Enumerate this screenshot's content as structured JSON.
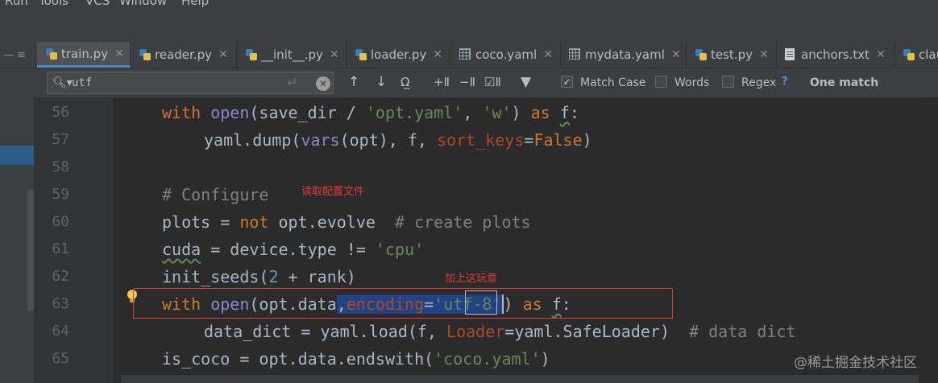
{
  "menu": [
    "Run",
    "Tools",
    "VCS",
    "Window",
    "Help"
  ],
  "tabs": [
    {
      "label": "train.py",
      "icon": "python-file-icon",
      "active": true
    },
    {
      "label": "reader.py",
      "icon": "python-file-icon"
    },
    {
      "label": "__init__.py",
      "icon": "python-file-icon"
    },
    {
      "label": "loader.py",
      "icon": "python-file-icon"
    },
    {
      "label": "coco.yaml",
      "icon": "yaml-file-icon"
    },
    {
      "label": "mydata.yaml",
      "icon": "yaml-file-icon"
    },
    {
      "label": "test.py",
      "icon": "python-file-icon"
    },
    {
      "label": "anchors.txt",
      "icon": "text-file-icon"
    },
    {
      "label": "clau",
      "icon": "python-file-icon"
    }
  ],
  "find": {
    "query": "utf",
    "match_case_label": "Match Case",
    "match_case_checked": true,
    "words_label": "Words",
    "words_checked": false,
    "regex_label": "Regex",
    "regex_checked": false,
    "help": "?",
    "result": "One match"
  },
  "line_numbers": [
    "56",
    "57",
    "58",
    "59",
    "60",
    "61",
    "62",
    "63",
    "64",
    "65"
  ],
  "code": {
    "l56": {
      "kw": "with",
      "fn": "open",
      "a": "(save_dir / ",
      "s1": "'opt.yaml'",
      "b": ", ",
      "s2": "'w'",
      "c": ") ",
      "as": "as",
      "d": " ",
      "f": "f",
      "e": ":"
    },
    "l57": {
      "a": "yaml.dump(",
      "fn": "vars",
      "b": "(opt), f, ",
      "p": "sort_keys",
      "eq": "=",
      "kw": "False",
      "c": ")"
    },
    "l59": {
      "comment": "# Configure"
    },
    "l60": {
      "a": "plots = ",
      "kw": "not",
      "b": " opt.evolve  ",
      "comment": "# create plots"
    },
    "l61": {
      "id": "cuda",
      "a": " = device.type != ",
      "s": "'cpu'"
    },
    "l62": {
      "a": "init_seeds(",
      "n": "2",
      "b": " + rank)"
    },
    "l63": {
      "kw": "with",
      "fn": "open",
      "a": "(opt.data",
      "comma": ",",
      "p": "encoding",
      "eq": "=",
      "q1": "'",
      "m": "utf",
      "s_rest": "-8",
      "q2": "'",
      "c": ") ",
      "as": "as",
      "d": " ",
      "f": "f",
      "e": ":"
    },
    "l64": {
      "a": "data_dict = yaml.load(f, ",
      "p": "Loader",
      "b": "=yaml.SafeLoader)  ",
      "comment": "# data dict"
    },
    "l65": {
      "a": "is_coco = opt.data.endswith(",
      "s": "'coco.yaml'",
      "b": ")"
    }
  },
  "annotations": {
    "read_config": "读取配置文件",
    "add_this": "加上这玩意"
  },
  "watermark": "@稀土掘金技术社区",
  "colors": {
    "keyword": "#cc7832",
    "string": "#6a8759",
    "number": "#6897bb",
    "comment": "#808080",
    "annotation": "#e03a3a"
  }
}
